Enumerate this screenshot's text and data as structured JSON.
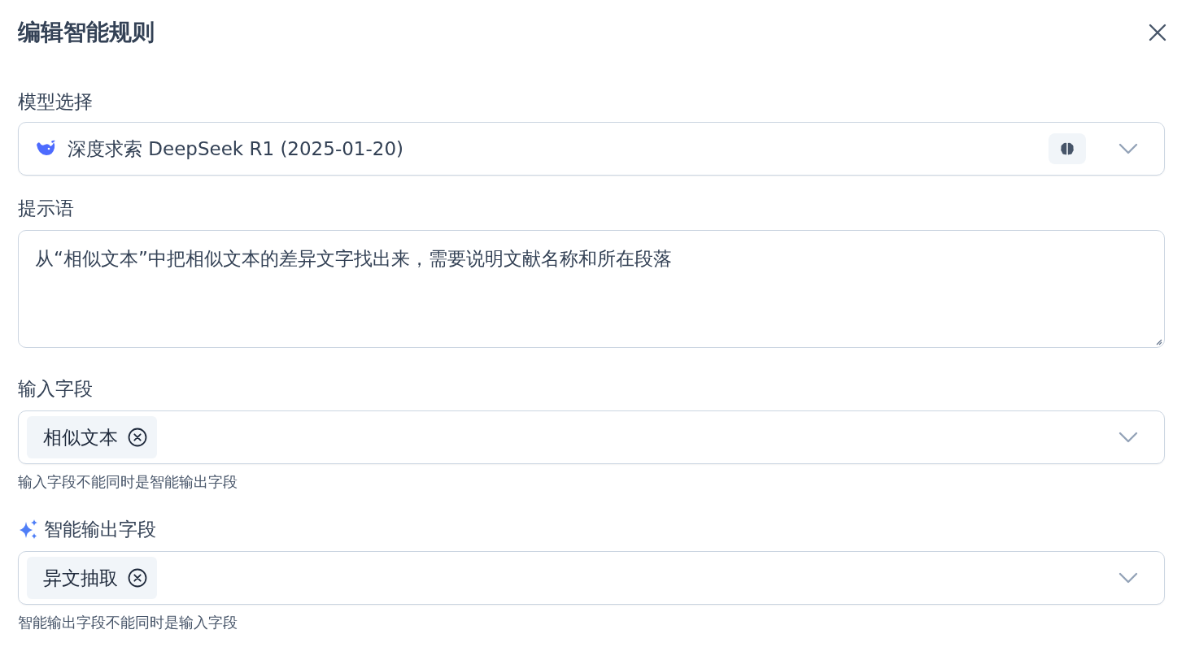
{
  "dialog": {
    "title": "编辑智能规则"
  },
  "fields": [
    {
      "kind": "model_select",
      "label": "模型选择",
      "value": "深度求索 DeepSeek R1 (2025-01-20)"
    },
    {
      "kind": "textarea",
      "label": "提示语",
      "value": "从“相似文本”中把相似文本的差异文字找出来，需要说明文献名称和所在段落"
    },
    {
      "kind": "tags",
      "label": "输入字段",
      "tags": [
        "相似文本"
      ],
      "hint": "输入字段不能同时是智能输出字段"
    },
    {
      "kind": "ai_tags",
      "label": "智能输出字段",
      "tags": [
        "异文抽取"
      ],
      "hint": "智能输出字段不能同时是输入字段"
    }
  ]
}
